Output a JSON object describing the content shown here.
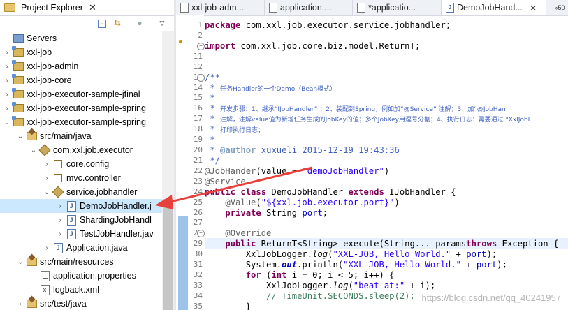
{
  "explorer": {
    "title": "Project Explorer",
    "close_glyph": "✕",
    "tree": [
      {
        "arrow": "",
        "icon": "servers",
        "label": "Servers",
        "indent": 0
      },
      {
        "arrow": ">",
        "icon": "project",
        "label": "xxl-job",
        "indent": 0
      },
      {
        "arrow": ">",
        "icon": "project",
        "label": "xxl-job-admin",
        "indent": 0
      },
      {
        "arrow": ">",
        "icon": "project",
        "label": "xxl-job-core",
        "indent": 0
      },
      {
        "arrow": ">",
        "icon": "project",
        "label": "xxl-job-executor-sample-jfinal",
        "indent": 0
      },
      {
        "arrow": ">",
        "icon": "project",
        "label": "xxl-job-executor-sample-spring",
        "indent": 0
      },
      {
        "arrow": "v",
        "icon": "project",
        "label": "xxl-job-executor-sample-spring",
        "indent": 0
      },
      {
        "arrow": "v",
        "icon": "srcfolder",
        "label": "src/main/java",
        "indent": 1
      },
      {
        "arrow": "v",
        "icon": "package",
        "label": "com.xxl.job.executor",
        "indent": 2
      },
      {
        "arrow": ">",
        "icon": "pkg-empty",
        "label": "core.config",
        "indent": 3
      },
      {
        "arrow": ">",
        "icon": "pkg-empty",
        "label": "mvc.controller",
        "indent": 3
      },
      {
        "arrow": "v",
        "icon": "package",
        "label": "service.jobhandler",
        "indent": 3
      },
      {
        "arrow": ">",
        "icon": "java",
        "label": "DemoJobHandler.j",
        "indent": 4,
        "selected": true
      },
      {
        "arrow": ">",
        "icon": "java",
        "label": "ShardingJobHandl",
        "indent": 4
      },
      {
        "arrow": ">",
        "icon": "java",
        "label": "TestJobHandler.jav",
        "indent": 4
      },
      {
        "arrow": ">",
        "icon": "java",
        "label": "Application.java",
        "indent": 3
      },
      {
        "arrow": "v",
        "icon": "srcfolder",
        "label": "src/main/resources",
        "indent": 1
      },
      {
        "arrow": "",
        "icon": "props",
        "label": "application.properties",
        "indent": 2
      },
      {
        "arrow": "",
        "icon": "xml",
        "label": "logback.xml",
        "indent": 2
      },
      {
        "arrow": ">",
        "icon": "srcfolder",
        "label": "src/test/java",
        "indent": 1
      }
    ]
  },
  "editor": {
    "tabs": [
      {
        "label": "xxl-job-adm...",
        "type": "xml",
        "active": false
      },
      {
        "label": "application....",
        "type": "xml",
        "active": false
      },
      {
        "label": "*applicatio...",
        "type": "xml",
        "active": false
      },
      {
        "label": "DemoJobHand...",
        "type": "java",
        "active": true,
        "close": "✕"
      }
    ],
    "overflow": "»50",
    "lines": [
      {
        "n": "1",
        "t": [
          [
            "kw",
            "package"
          ],
          [
            "",
            "com.xxl.job.executor.service.jobhandler;"
          ]
        ]
      },
      {
        "n": "2",
        "t": []
      },
      {
        "n": "3",
        "fold": "+",
        "t": [
          [
            "kw",
            "import"
          ],
          [
            "",
            "com.xxl.job.core.biz.model.ReturnT;"
          ]
        ]
      },
      {
        "n": "11",
        "t": []
      },
      {
        "n": "12",
        "t": []
      },
      {
        "n": "13",
        "fold": "-",
        "t": [
          [
            "jd",
            "/**"
          ]
        ]
      },
      {
        "n": "14",
        "t": [
          [
            "jd",
            " * "
          ],
          [
            "jd small-cn",
            "任务Handler的一个Demo（Bean模式）"
          ]
        ]
      },
      {
        "n": "15",
        "t": [
          [
            "jd",
            " *"
          ]
        ]
      },
      {
        "n": "16",
        "t": [
          [
            "jd",
            " * "
          ],
          [
            "jd small-cn",
            "开发步骤：1、继承“IJobHandler” ；2、装配到Spring，例如加“@Service” 注解；3、加“@JobHan"
          ]
        ]
      },
      {
        "n": "17",
        "t": [
          [
            "jd",
            " * "
          ],
          [
            "jd small-cn",
            "注解，注解value值为新增任务生成的JobKey的值；多个JobKey用逗号分割；4、执行日志：需要通过 \"XxlJobL"
          ]
        ]
      },
      {
        "n": "18",
        "t": [
          [
            "jd",
            " * "
          ],
          [
            "jd small-cn",
            "打印执行日志；"
          ]
        ]
      },
      {
        "n": "19",
        "t": [
          [
            "jd",
            " *"
          ]
        ]
      },
      {
        "n": "20",
        "t": [
          [
            "jd",
            " * "
          ],
          [
            "jdtag",
            "@author"
          ],
          [
            "jd",
            " xuxueli 2015-12-19 19:43:36"
          ]
        ]
      },
      {
        "n": "21",
        "t": [
          [
            "jd",
            " */"
          ]
        ]
      },
      {
        "n": "22",
        "t": [
          [
            "ann",
            "@JobHander"
          ],
          [
            "",
            "(value = "
          ],
          [
            "str",
            "\"demoJobHandler\""
          ],
          [
            "",
            ")"
          ]
        ]
      },
      {
        "n": "23",
        "t": [
          [
            "ann",
            "@Service"
          ]
        ]
      },
      {
        "n": "24",
        "t": [
          [
            "kw",
            "public class"
          ],
          [
            "",
            " DemoJobHandler "
          ],
          [
            "kw",
            "extends"
          ],
          [
            "",
            " IJobHandler {"
          ]
        ]
      },
      {
        "n": "25",
        "t": [
          [
            "",
            "    "
          ],
          [
            "ann",
            "@Value"
          ],
          [
            "",
            "("
          ],
          [
            "str",
            "\"${xxl.job.executor.port}\""
          ],
          [
            "",
            ")"
          ]
        ]
      },
      {
        "n": "26",
        "t": [
          [
            "",
            "    "
          ],
          [
            "kw",
            "private"
          ],
          [
            "",
            " String "
          ],
          [
            "fld",
            "port"
          ],
          [
            "",
            ";"
          ]
        ]
      },
      {
        "n": "27",
        "t": []
      },
      {
        "n": "28",
        "fold": "-",
        "t": [
          [
            "",
            "    "
          ],
          [
            "ann",
            "@Override"
          ]
        ]
      },
      {
        "n": "29",
        "hl": true,
        "t": [
          [
            "",
            "    "
          ],
          [
            "kw",
            "public"
          ],
          [
            "",
            " ReturnT<String> execute(String... "
          ],
          [
            "",
            "params"
          ],
          [
            ") "
          ],
          [
            "kw",
            "throws"
          ],
          [
            "",
            " Exception {"
          ]
        ]
      },
      {
        "n": "30",
        "t": [
          [
            "",
            "        XxlJobLogger."
          ],
          [
            "it",
            "log"
          ],
          [
            "",
            "("
          ],
          [
            "str",
            "\"XXL-JOB, Hello World.\""
          ],
          [
            "",
            " + "
          ],
          [
            "fld",
            "port"
          ],
          [
            "",
            ");"
          ]
        ]
      },
      {
        "n": "31",
        "t": [
          [
            "",
            "        System."
          ],
          [
            "sf",
            "out"
          ],
          [
            "",
            ".println("
          ],
          [
            "str",
            "\"XXL-JOB, Hello World.\""
          ],
          [
            "",
            " + "
          ],
          [
            "fld",
            "port"
          ],
          [
            "",
            ");"
          ]
        ]
      },
      {
        "n": "32",
        "t": [
          [
            "",
            "        "
          ],
          [
            "kw",
            "for"
          ],
          [
            "",
            " ("
          ],
          [
            "kw",
            "int"
          ],
          [
            "",
            " i = 0; i < 5; i++) {"
          ]
        ]
      },
      {
        "n": "33",
        "t": [
          [
            "",
            "            XxlJobLogger."
          ],
          [
            "it",
            "log"
          ],
          [
            "",
            "("
          ],
          [
            "str",
            "\"beat at:\""
          ],
          [
            "",
            " + i);"
          ]
        ]
      },
      {
        "n": "34",
        "t": [
          [
            "",
            "            "
          ],
          [
            "cm",
            "// TimeUnit.SECONDS.sleep(2);"
          ]
        ]
      },
      {
        "n": "35",
        "t": [
          [
            "",
            "        }"
          ]
        ]
      },
      {
        "n": "36",
        "t": [
          [
            "",
            "        "
          ],
          [
            "kw",
            "return"
          ],
          [
            "",
            " ReturnT."
          ],
          [
            "sf",
            "SUCCESS"
          ],
          [
            "",
            ";"
          ]
        ]
      }
    ]
  },
  "watermark": "https://blog.csdn.net/qq_40241957",
  "colors": {
    "arrow": "#e8403a",
    "selection": "#cce8ff",
    "keyword": "#7f0055",
    "string": "#2a00ff",
    "javadoc": "#3f5fbf"
  }
}
